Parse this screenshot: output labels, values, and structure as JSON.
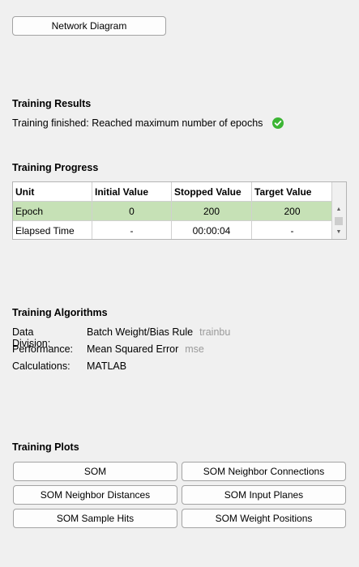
{
  "network_button": "Network Diagram",
  "training_results": {
    "title": "Training Results",
    "status": "Training finished: Reached maximum number of epochs",
    "status_icon": "check-circle-icon",
    "status_color": "#3cb534"
  },
  "training_progress": {
    "title": "Training Progress",
    "columns": [
      "Unit",
      "Initial Value",
      "Stopped Value",
      "Target Value"
    ],
    "rows": [
      [
        "Epoch",
        "0",
        "200",
        "200"
      ],
      [
        "Elapsed Time",
        "-",
        "00:00:04",
        "-"
      ]
    ],
    "selected_row_color": "#c6e1b6"
  },
  "training_algorithms": {
    "title": "Training Algorithms",
    "items": [
      {
        "label": "Data Division:",
        "value": "Batch Weight/Bias Rule",
        "code": "trainbu"
      },
      {
        "label": "Performance:",
        "value": "Mean Squared Error",
        "code": "mse"
      },
      {
        "label": "Calculations:",
        "value": "MATLAB",
        "code": ""
      }
    ]
  },
  "training_plots": {
    "title": "Training Plots",
    "buttons": [
      "SOM",
      "SOM Neighbor Connections",
      "SOM Neighbor Distances",
      "SOM Input Planes",
      "SOM Sample Hits",
      "SOM Weight Positions"
    ]
  }
}
